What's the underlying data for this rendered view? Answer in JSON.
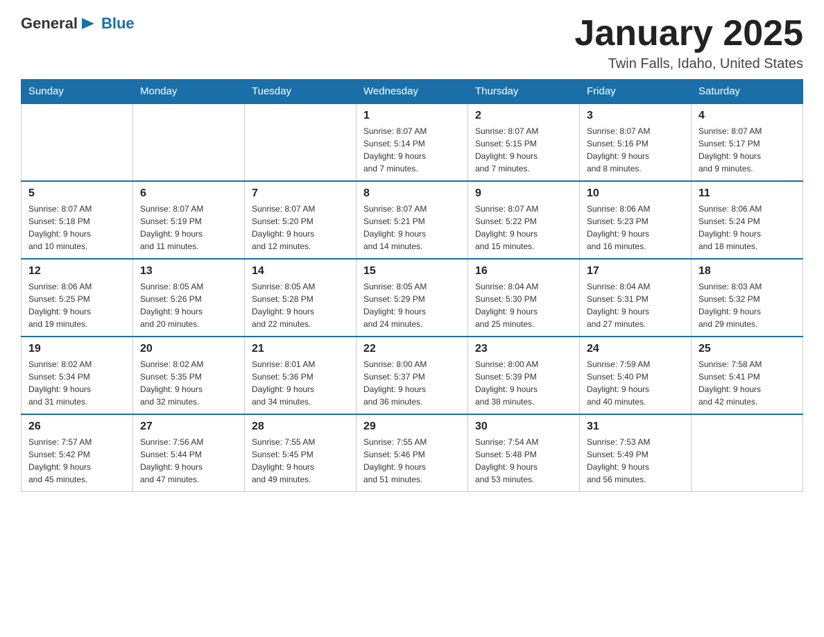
{
  "header": {
    "logo": {
      "general": "General",
      "arrow_icon": "▶",
      "blue": "Blue"
    },
    "title": "January 2025",
    "subtitle": "Twin Falls, Idaho, United States"
  },
  "days_of_week": [
    "Sunday",
    "Monday",
    "Tuesday",
    "Wednesday",
    "Thursday",
    "Friday",
    "Saturday"
  ],
  "weeks": [
    [
      {
        "day": "",
        "info": ""
      },
      {
        "day": "",
        "info": ""
      },
      {
        "day": "",
        "info": ""
      },
      {
        "day": "1",
        "info": "Sunrise: 8:07 AM\nSunset: 5:14 PM\nDaylight: 9 hours\nand 7 minutes."
      },
      {
        "day": "2",
        "info": "Sunrise: 8:07 AM\nSunset: 5:15 PM\nDaylight: 9 hours\nand 7 minutes."
      },
      {
        "day": "3",
        "info": "Sunrise: 8:07 AM\nSunset: 5:16 PM\nDaylight: 9 hours\nand 8 minutes."
      },
      {
        "day": "4",
        "info": "Sunrise: 8:07 AM\nSunset: 5:17 PM\nDaylight: 9 hours\nand 9 minutes."
      }
    ],
    [
      {
        "day": "5",
        "info": "Sunrise: 8:07 AM\nSunset: 5:18 PM\nDaylight: 9 hours\nand 10 minutes."
      },
      {
        "day": "6",
        "info": "Sunrise: 8:07 AM\nSunset: 5:19 PM\nDaylight: 9 hours\nand 11 minutes."
      },
      {
        "day": "7",
        "info": "Sunrise: 8:07 AM\nSunset: 5:20 PM\nDaylight: 9 hours\nand 12 minutes."
      },
      {
        "day": "8",
        "info": "Sunrise: 8:07 AM\nSunset: 5:21 PM\nDaylight: 9 hours\nand 14 minutes."
      },
      {
        "day": "9",
        "info": "Sunrise: 8:07 AM\nSunset: 5:22 PM\nDaylight: 9 hours\nand 15 minutes."
      },
      {
        "day": "10",
        "info": "Sunrise: 8:06 AM\nSunset: 5:23 PM\nDaylight: 9 hours\nand 16 minutes."
      },
      {
        "day": "11",
        "info": "Sunrise: 8:06 AM\nSunset: 5:24 PM\nDaylight: 9 hours\nand 18 minutes."
      }
    ],
    [
      {
        "day": "12",
        "info": "Sunrise: 8:06 AM\nSunset: 5:25 PM\nDaylight: 9 hours\nand 19 minutes."
      },
      {
        "day": "13",
        "info": "Sunrise: 8:05 AM\nSunset: 5:26 PM\nDaylight: 9 hours\nand 20 minutes."
      },
      {
        "day": "14",
        "info": "Sunrise: 8:05 AM\nSunset: 5:28 PM\nDaylight: 9 hours\nand 22 minutes."
      },
      {
        "day": "15",
        "info": "Sunrise: 8:05 AM\nSunset: 5:29 PM\nDaylight: 9 hours\nand 24 minutes."
      },
      {
        "day": "16",
        "info": "Sunrise: 8:04 AM\nSunset: 5:30 PM\nDaylight: 9 hours\nand 25 minutes."
      },
      {
        "day": "17",
        "info": "Sunrise: 8:04 AM\nSunset: 5:31 PM\nDaylight: 9 hours\nand 27 minutes."
      },
      {
        "day": "18",
        "info": "Sunrise: 8:03 AM\nSunset: 5:32 PM\nDaylight: 9 hours\nand 29 minutes."
      }
    ],
    [
      {
        "day": "19",
        "info": "Sunrise: 8:02 AM\nSunset: 5:34 PM\nDaylight: 9 hours\nand 31 minutes."
      },
      {
        "day": "20",
        "info": "Sunrise: 8:02 AM\nSunset: 5:35 PM\nDaylight: 9 hours\nand 32 minutes."
      },
      {
        "day": "21",
        "info": "Sunrise: 8:01 AM\nSunset: 5:36 PM\nDaylight: 9 hours\nand 34 minutes."
      },
      {
        "day": "22",
        "info": "Sunrise: 8:00 AM\nSunset: 5:37 PM\nDaylight: 9 hours\nand 36 minutes."
      },
      {
        "day": "23",
        "info": "Sunrise: 8:00 AM\nSunset: 5:39 PM\nDaylight: 9 hours\nand 38 minutes."
      },
      {
        "day": "24",
        "info": "Sunrise: 7:59 AM\nSunset: 5:40 PM\nDaylight: 9 hours\nand 40 minutes."
      },
      {
        "day": "25",
        "info": "Sunrise: 7:58 AM\nSunset: 5:41 PM\nDaylight: 9 hours\nand 42 minutes."
      }
    ],
    [
      {
        "day": "26",
        "info": "Sunrise: 7:57 AM\nSunset: 5:42 PM\nDaylight: 9 hours\nand 45 minutes."
      },
      {
        "day": "27",
        "info": "Sunrise: 7:56 AM\nSunset: 5:44 PM\nDaylight: 9 hours\nand 47 minutes."
      },
      {
        "day": "28",
        "info": "Sunrise: 7:55 AM\nSunset: 5:45 PM\nDaylight: 9 hours\nand 49 minutes."
      },
      {
        "day": "29",
        "info": "Sunrise: 7:55 AM\nSunset: 5:46 PM\nDaylight: 9 hours\nand 51 minutes."
      },
      {
        "day": "30",
        "info": "Sunrise: 7:54 AM\nSunset: 5:48 PM\nDaylight: 9 hours\nand 53 minutes."
      },
      {
        "day": "31",
        "info": "Sunrise: 7:53 AM\nSunset: 5:49 PM\nDaylight: 9 hours\nand 56 minutes."
      },
      {
        "day": "",
        "info": ""
      }
    ]
  ]
}
